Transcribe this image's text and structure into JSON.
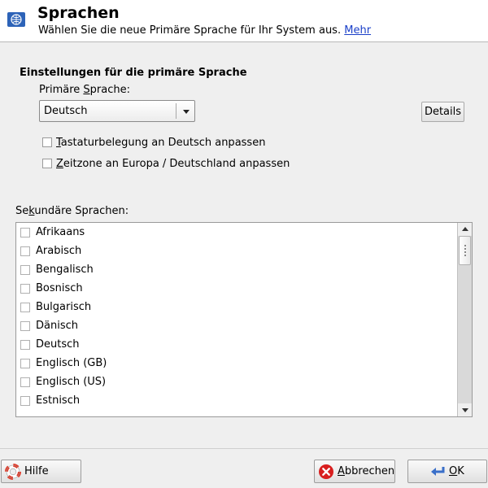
{
  "header": {
    "title": "Sprachen",
    "subtitle": "Wählen Sie die neue Primäre Sprache für Ihr System aus.",
    "more_link": "Mehr",
    "icon": "globe-flag-icon"
  },
  "primary": {
    "section_title": "Einstellungen für die primäre Sprache",
    "label_pre": "Primäre ",
    "label_accel": "S",
    "label_post": "prache:",
    "selected": "Deutsch",
    "details_label": "Details",
    "keyboard": {
      "accel": "T",
      "rest": "astaturbelegung an Deutsch anpassen",
      "checked": false
    },
    "timezone": {
      "accel": "Z",
      "rest": "eitzone an Europa / Deutschland anpassen",
      "checked": false
    }
  },
  "secondary": {
    "label_pre": "Se",
    "label_accel": "k",
    "label_post": "undäre Sprachen:",
    "items": [
      {
        "label": "Afrikaans",
        "checked": false
      },
      {
        "label": "Arabisch",
        "checked": false
      },
      {
        "label": "Bengalisch",
        "checked": false
      },
      {
        "label": "Bosnisch",
        "checked": false
      },
      {
        "label": "Bulgarisch",
        "checked": false
      },
      {
        "label": "Dänisch",
        "checked": false
      },
      {
        "label": "Deutsch",
        "checked": false
      },
      {
        "label": "Englisch (GB)",
        "checked": false
      },
      {
        "label": "Englisch (US)",
        "checked": false
      },
      {
        "label": "Estnisch",
        "checked": false
      }
    ]
  },
  "buttons": {
    "help": "Hilfe",
    "cancel_accel": "A",
    "cancel_rest": "bbrechen",
    "ok_accel": "O",
    "ok_rest": "K"
  },
  "colors": {
    "link": "#1a3fc8",
    "cancel_icon": "#d81e1e",
    "ok_arrow": "#3a6fc9",
    "help_ring": "#e23b2a"
  }
}
